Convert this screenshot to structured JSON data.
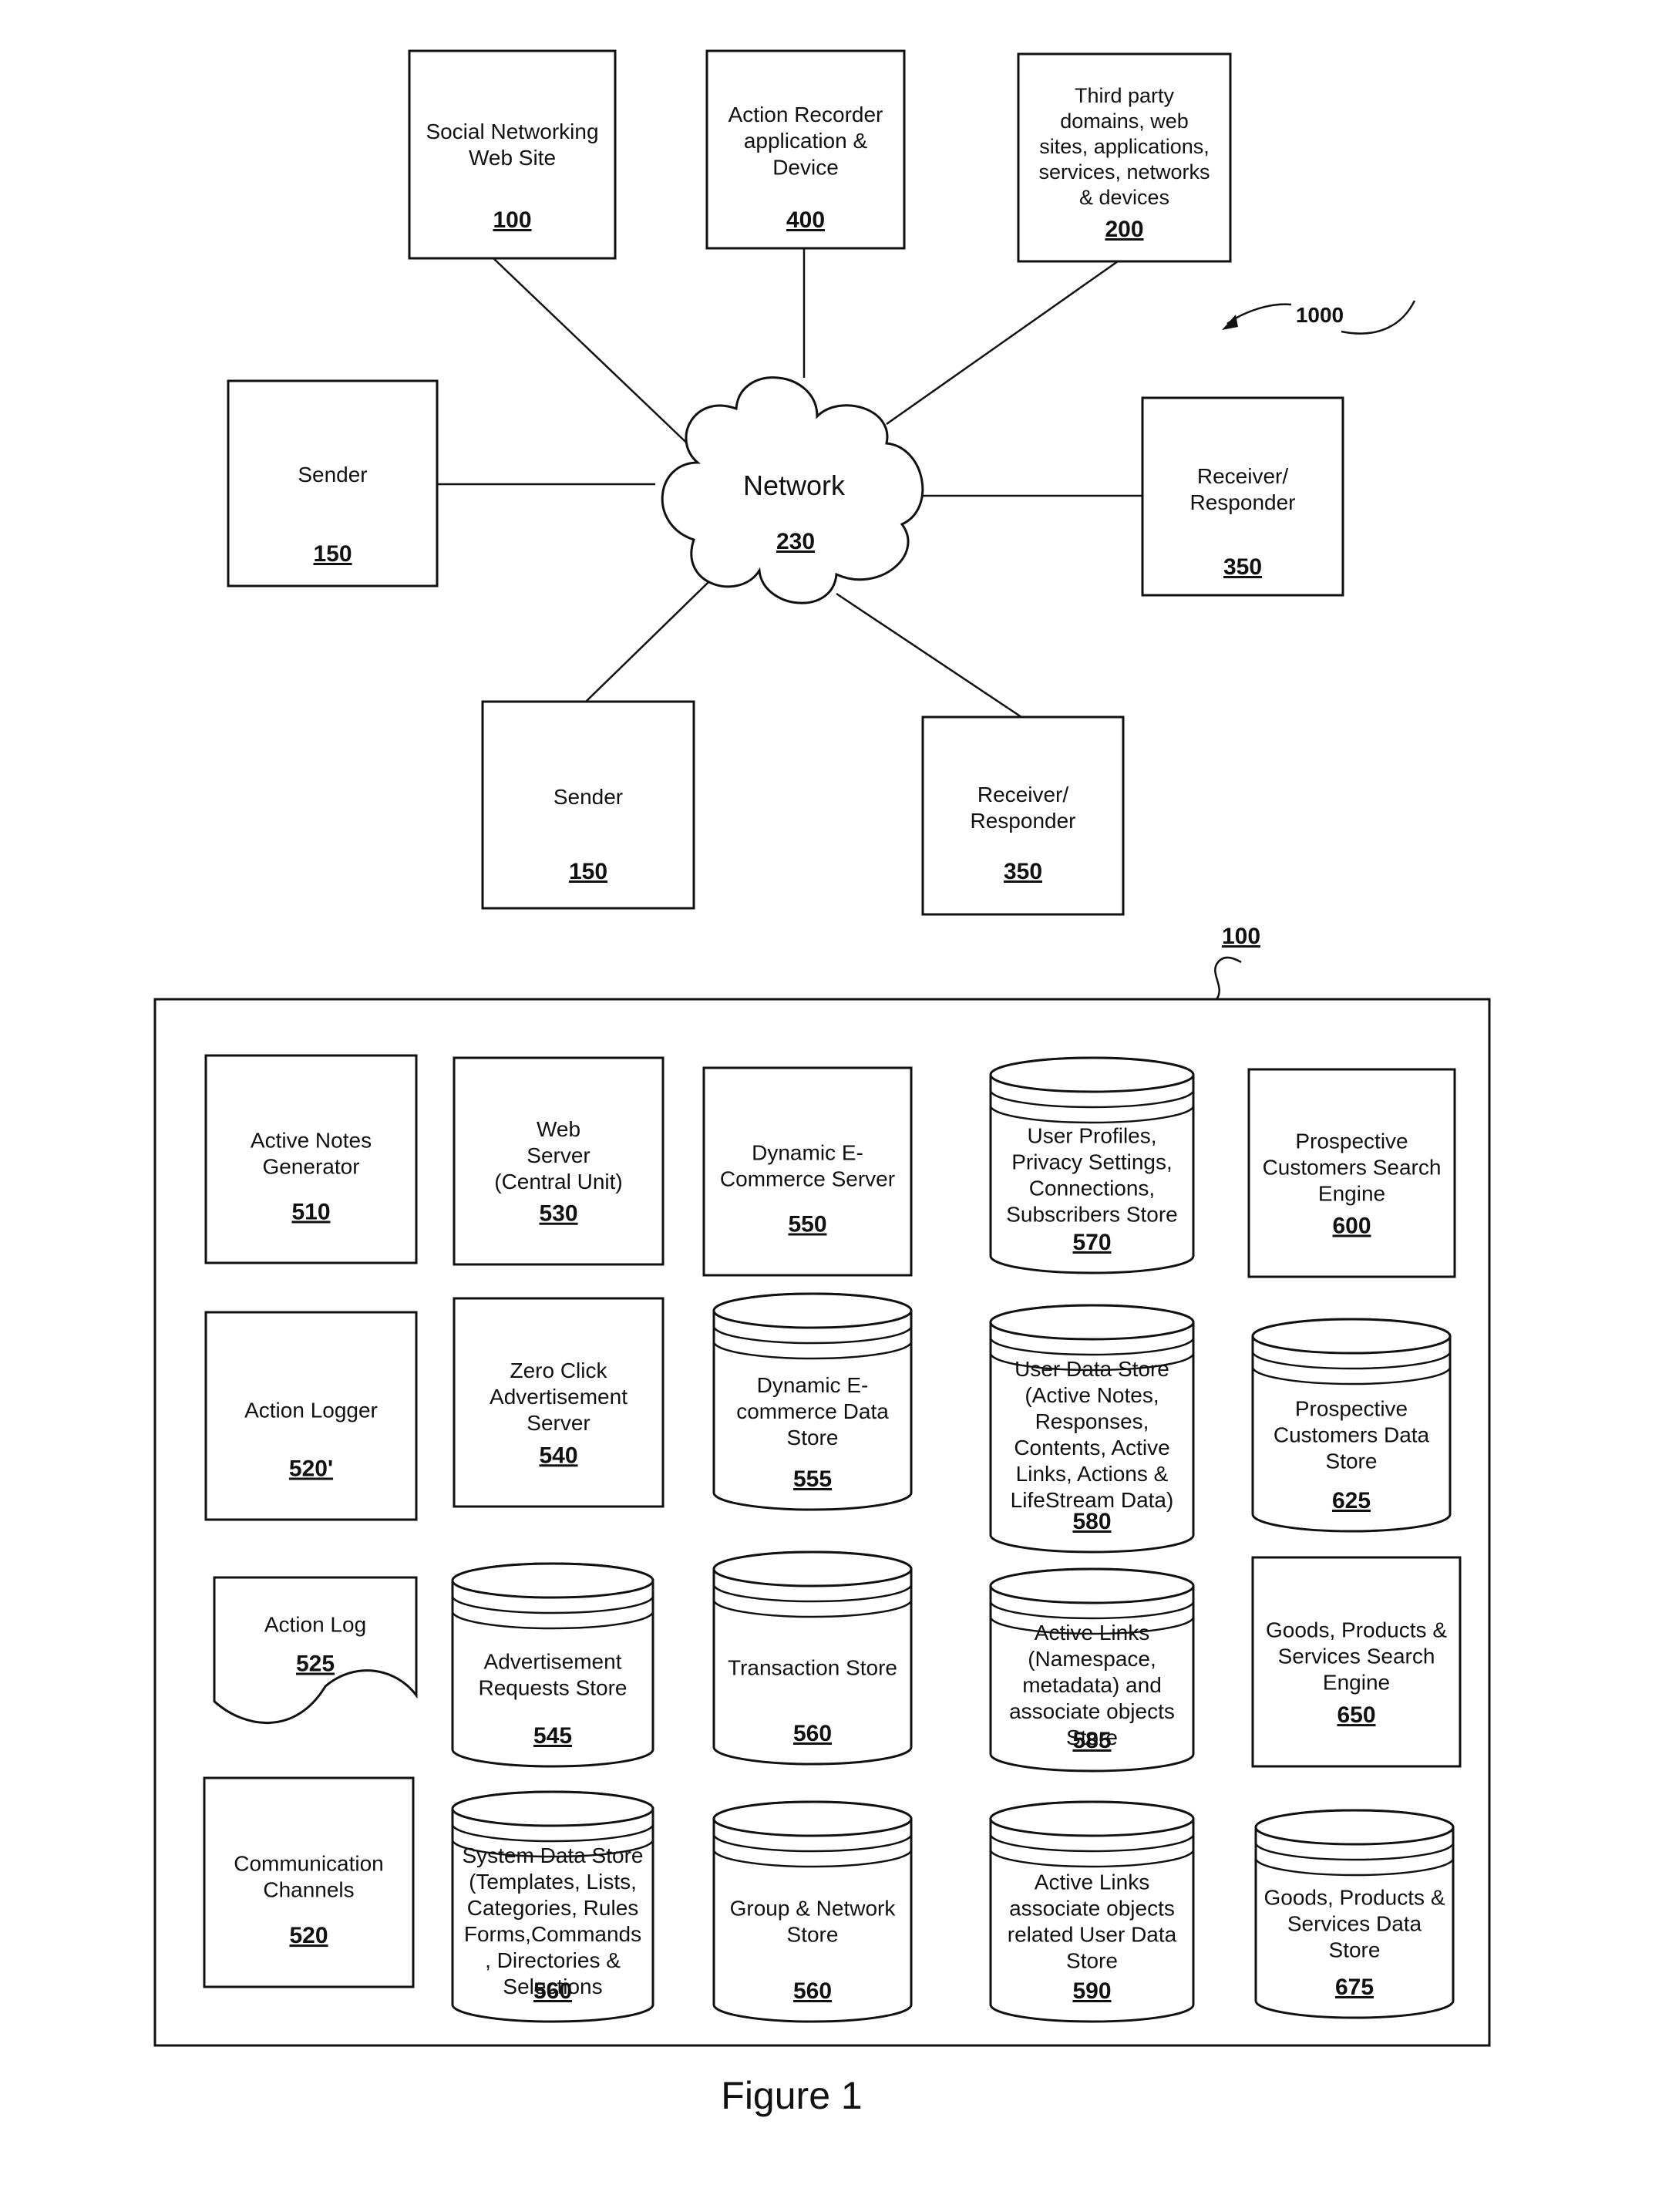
{
  "figure": {
    "caption": "Figure 1",
    "system_ref": "1000",
    "container_ref": "100"
  },
  "network": {
    "label": "Network",
    "ref": "230",
    "nodes": [
      {
        "id": "social",
        "lines": [
          "Social Networking",
          "Web Site"
        ],
        "ref": "100"
      },
      {
        "id": "recorder",
        "lines": [
          "Action Recorder",
          "application &",
          "Device"
        ],
        "ref": "400"
      },
      {
        "id": "thirdparty",
        "lines": [
          "Third party",
          "domains, web",
          "sites, applications,",
          "services, networks",
          "& devices"
        ],
        "ref": "200"
      },
      {
        "id": "sender-left",
        "lines": [
          "Sender"
        ],
        "ref": "150"
      },
      {
        "id": "receiver-right",
        "lines": [
          "Receiver/",
          "Responder"
        ],
        "ref": "350"
      },
      {
        "id": "sender-bottom",
        "lines": [
          "Sender"
        ],
        "ref": "150"
      },
      {
        "id": "receiver-bottom",
        "lines": [
          "Receiver/",
          "Responder"
        ],
        "ref": "350"
      }
    ]
  },
  "components": [
    {
      "shape": "box",
      "lines": [
        "Active Notes",
        "Generator"
      ],
      "ref": "510"
    },
    {
      "shape": "box",
      "lines": [
        "Web",
        "Server",
        "(Central Unit)"
      ],
      "ref": "530"
    },
    {
      "shape": "box",
      "lines": [
        "Dynamic E-",
        "Commerce Server"
      ],
      "ref": "550"
    },
    {
      "shape": "cylinder",
      "lines": [
        "User Profiles,",
        "Privacy Settings,",
        "Connections,",
        "Subscribers Store"
      ],
      "ref": "570"
    },
    {
      "shape": "box",
      "lines": [
        "Prospective",
        "Customers Search",
        "Engine"
      ],
      "ref": "600"
    },
    {
      "shape": "box",
      "lines": [
        "Action Logger"
      ],
      "ref": "520'"
    },
    {
      "shape": "box",
      "lines": [
        "Zero Click",
        "Advertisement",
        "Server"
      ],
      "ref": "540"
    },
    {
      "shape": "cylinder",
      "lines": [
        "Dynamic E-",
        "commerce Data",
        "Store"
      ],
      "ref": "555"
    },
    {
      "shape": "cylinder",
      "lines": [
        "User Data Store",
        "(Active Notes,",
        "Responses,",
        "Contents, Active",
        "Links, Actions &",
        "LifeStream Data)"
      ],
      "ref": "580"
    },
    {
      "shape": "cylinder",
      "lines": [
        "Prospective",
        "Customers Data",
        "Store"
      ],
      "ref": "625"
    },
    {
      "shape": "document",
      "lines": [
        "Action Log"
      ],
      "ref": "525"
    },
    {
      "shape": "cylinder",
      "lines": [
        "Advertisement",
        "Requests Store"
      ],
      "ref": "545"
    },
    {
      "shape": "cylinder",
      "lines": [
        "Transaction Store"
      ],
      "ref": "560"
    },
    {
      "shape": "cylinder",
      "lines": [
        "Active Links",
        "(Namespace,",
        "metadata) and",
        "associate objects",
        "Store"
      ],
      "ref": "585"
    },
    {
      "shape": "box",
      "lines": [
        "Goods, Products &",
        "Services Search",
        "Engine"
      ],
      "ref": "650"
    },
    {
      "shape": "box",
      "lines": [
        "Communication",
        "Channels"
      ],
      "ref": "520"
    },
    {
      "shape": "cylinder",
      "lines": [
        "System Data Store",
        "(Templates, Lists,",
        "Categories, Rules",
        "Forms,Commands",
        ", Directories &",
        "Selections"
      ],
      "ref": "560"
    },
    {
      "shape": "cylinder",
      "lines": [
        "Group & Network",
        "Store"
      ],
      "ref": "560"
    },
    {
      "shape": "cylinder",
      "lines": [
        "Active Links",
        "associate objects",
        "related User Data",
        "Store"
      ],
      "ref": "590"
    },
    {
      "shape": "cylinder",
      "lines": [
        "Goods, Products &",
        "Services Data",
        "Store"
      ],
      "ref": "675"
    }
  ]
}
